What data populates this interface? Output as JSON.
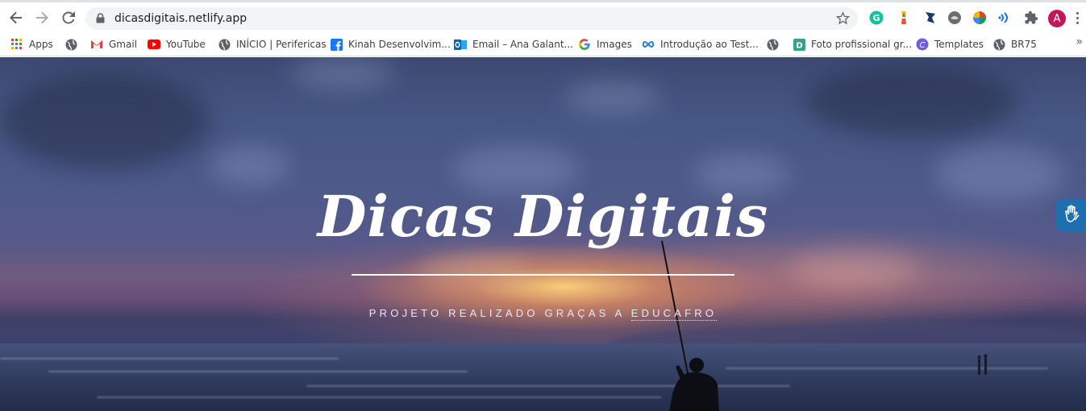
{
  "browser": {
    "url": "dicasdigitais.netlify.app",
    "profile_initial": "A",
    "icons": [
      "back-icon",
      "forward-icon",
      "reload-icon",
      "lock-icon",
      "star-icon"
    ]
  },
  "extensions": [
    "grammarly-icon",
    "lighthouse-icon",
    "extension-blue-icon",
    "extension-grey-icon",
    "colorzilla-icon",
    "wifi-ext-icon",
    "puzzle-icon"
  ],
  "bookmarks": [
    {
      "label": "Apps",
      "icon": "apps-grid-icon"
    },
    {
      "label": "",
      "icon": "globe-icon"
    },
    {
      "label": "Gmail",
      "icon": "gmail-icon"
    },
    {
      "label": "YouTube",
      "icon": "youtube-icon"
    },
    {
      "label": "INÍCIO | Perifericas",
      "icon": "globe-icon"
    },
    {
      "label": "Kinah Desenvolvim...",
      "icon": "facebook-icon"
    },
    {
      "label": "Email – Ana Galant...",
      "icon": "outlook-icon"
    },
    {
      "label": "Images",
      "icon": "google-icon"
    },
    {
      "label": "Introdução ao Test...",
      "icon": "infinity-icon"
    },
    {
      "label": "",
      "icon": "globe-icon"
    },
    {
      "label": "Foto profissional gr...",
      "icon": "d-icon"
    },
    {
      "label": "Templates",
      "icon": "canva-icon"
    },
    {
      "label": "BR75",
      "icon": "globe-icon"
    }
  ],
  "more_bookmarks": "»",
  "hero": {
    "title": "Dicas Digitais",
    "subtitle_prefix": "PROJETO REALIZADO GRAÇAS A ",
    "subtitle_link": "EDUCAFRO"
  },
  "colors": {
    "chrome_omnibox": "#f1f3f4",
    "avatar": "#c2185b",
    "vlibras": "#1e6fb0"
  }
}
